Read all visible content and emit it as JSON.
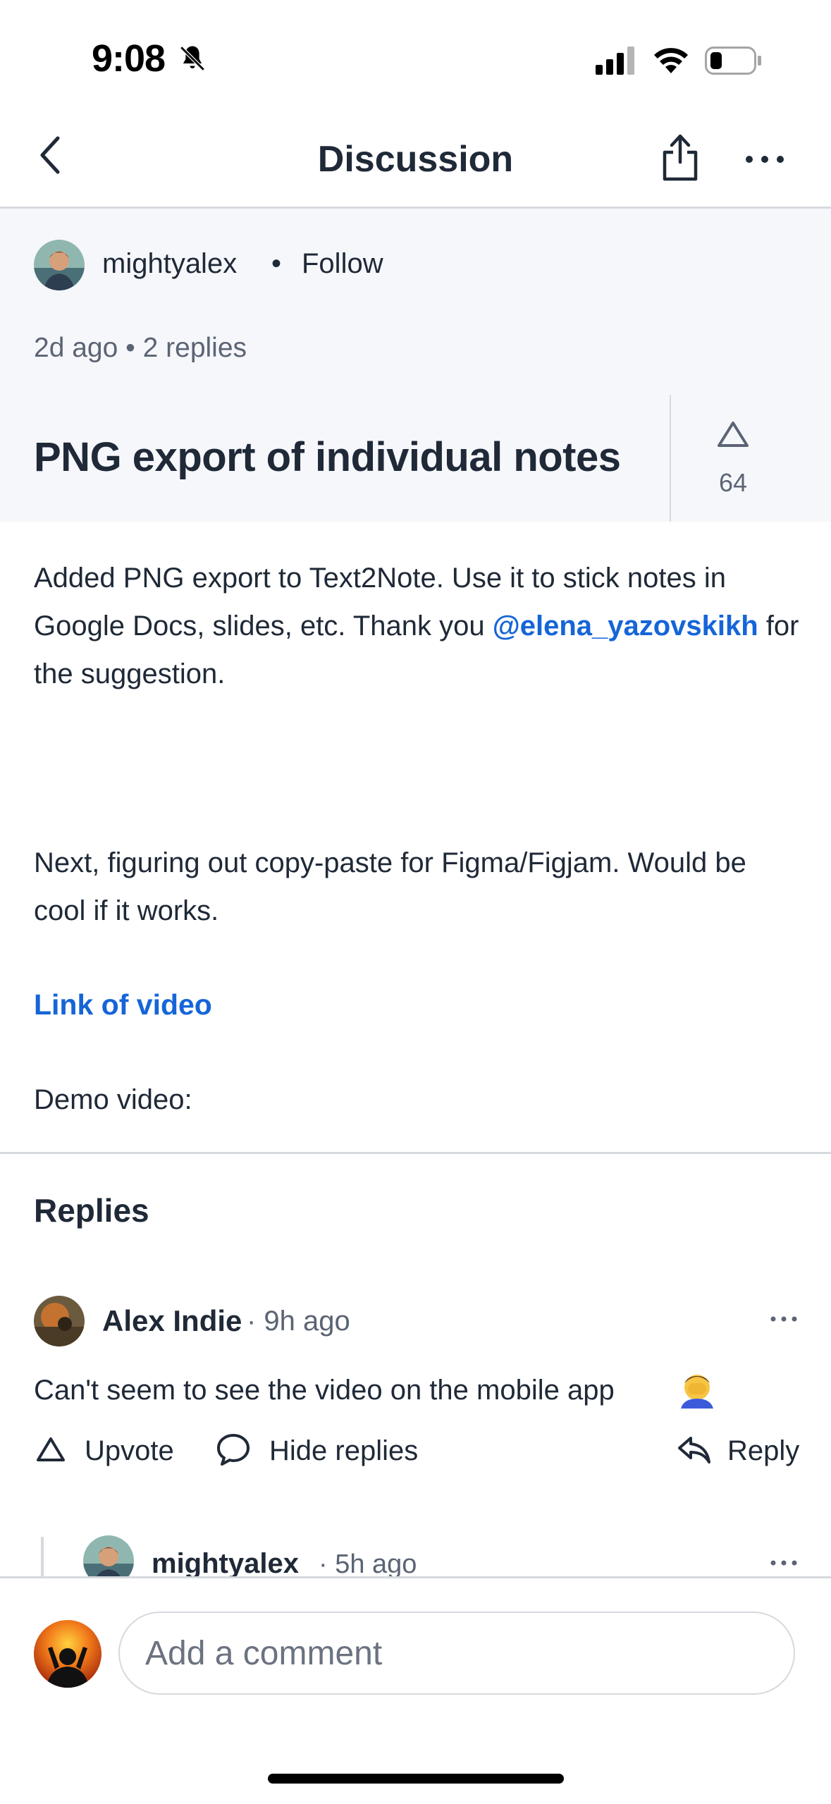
{
  "status_bar": {
    "time": "9:08"
  },
  "nav": {
    "title": "Discussion"
  },
  "post": {
    "author": "mightyalex",
    "separator": "•",
    "follow_label": "Follow",
    "meta": "2d ago • 2 replies",
    "title": "PNG export of individual notes",
    "upvotes": "64",
    "body_1_pre": "Added PNG export to Text2Note. Use it to stick notes in Google Docs, slides, etc. Thank you ",
    "body_1_mention": "@elena_yazovskikh",
    "body_1_post": " for the suggestion.",
    "body_2": "Next, figuring out copy-paste for Figma/Figjam. Would be cool if it works.",
    "video_link": "Link of video",
    "demo_label": "Demo video:"
  },
  "replies": {
    "heading": "Replies",
    "items": [
      {
        "author": "Alex Indie",
        "time": "· 9h ago",
        "text": "Can't seem to see the video on the mobile app",
        "upvote_label": "Upvote",
        "hide_label": "Hide replies",
        "reply_label": "Reply"
      }
    ],
    "nested": {
      "author": "mightyalex",
      "time": "· 5h ago"
    }
  },
  "composer": {
    "placeholder": "Add a comment"
  },
  "colors": {
    "accent": "#1565d8",
    "text": "#1f2937",
    "muted": "#5b6474",
    "band": "#f6f7fb",
    "divider": "#d6d9de"
  },
  "icons": [
    "bell-slash-icon",
    "signal-icon",
    "wifi-icon",
    "battery-icon",
    "back-chevron-icon",
    "share-icon",
    "more-icon",
    "upvote-icon",
    "comment-icon",
    "reply-icon",
    "facepalm-emoji"
  ]
}
